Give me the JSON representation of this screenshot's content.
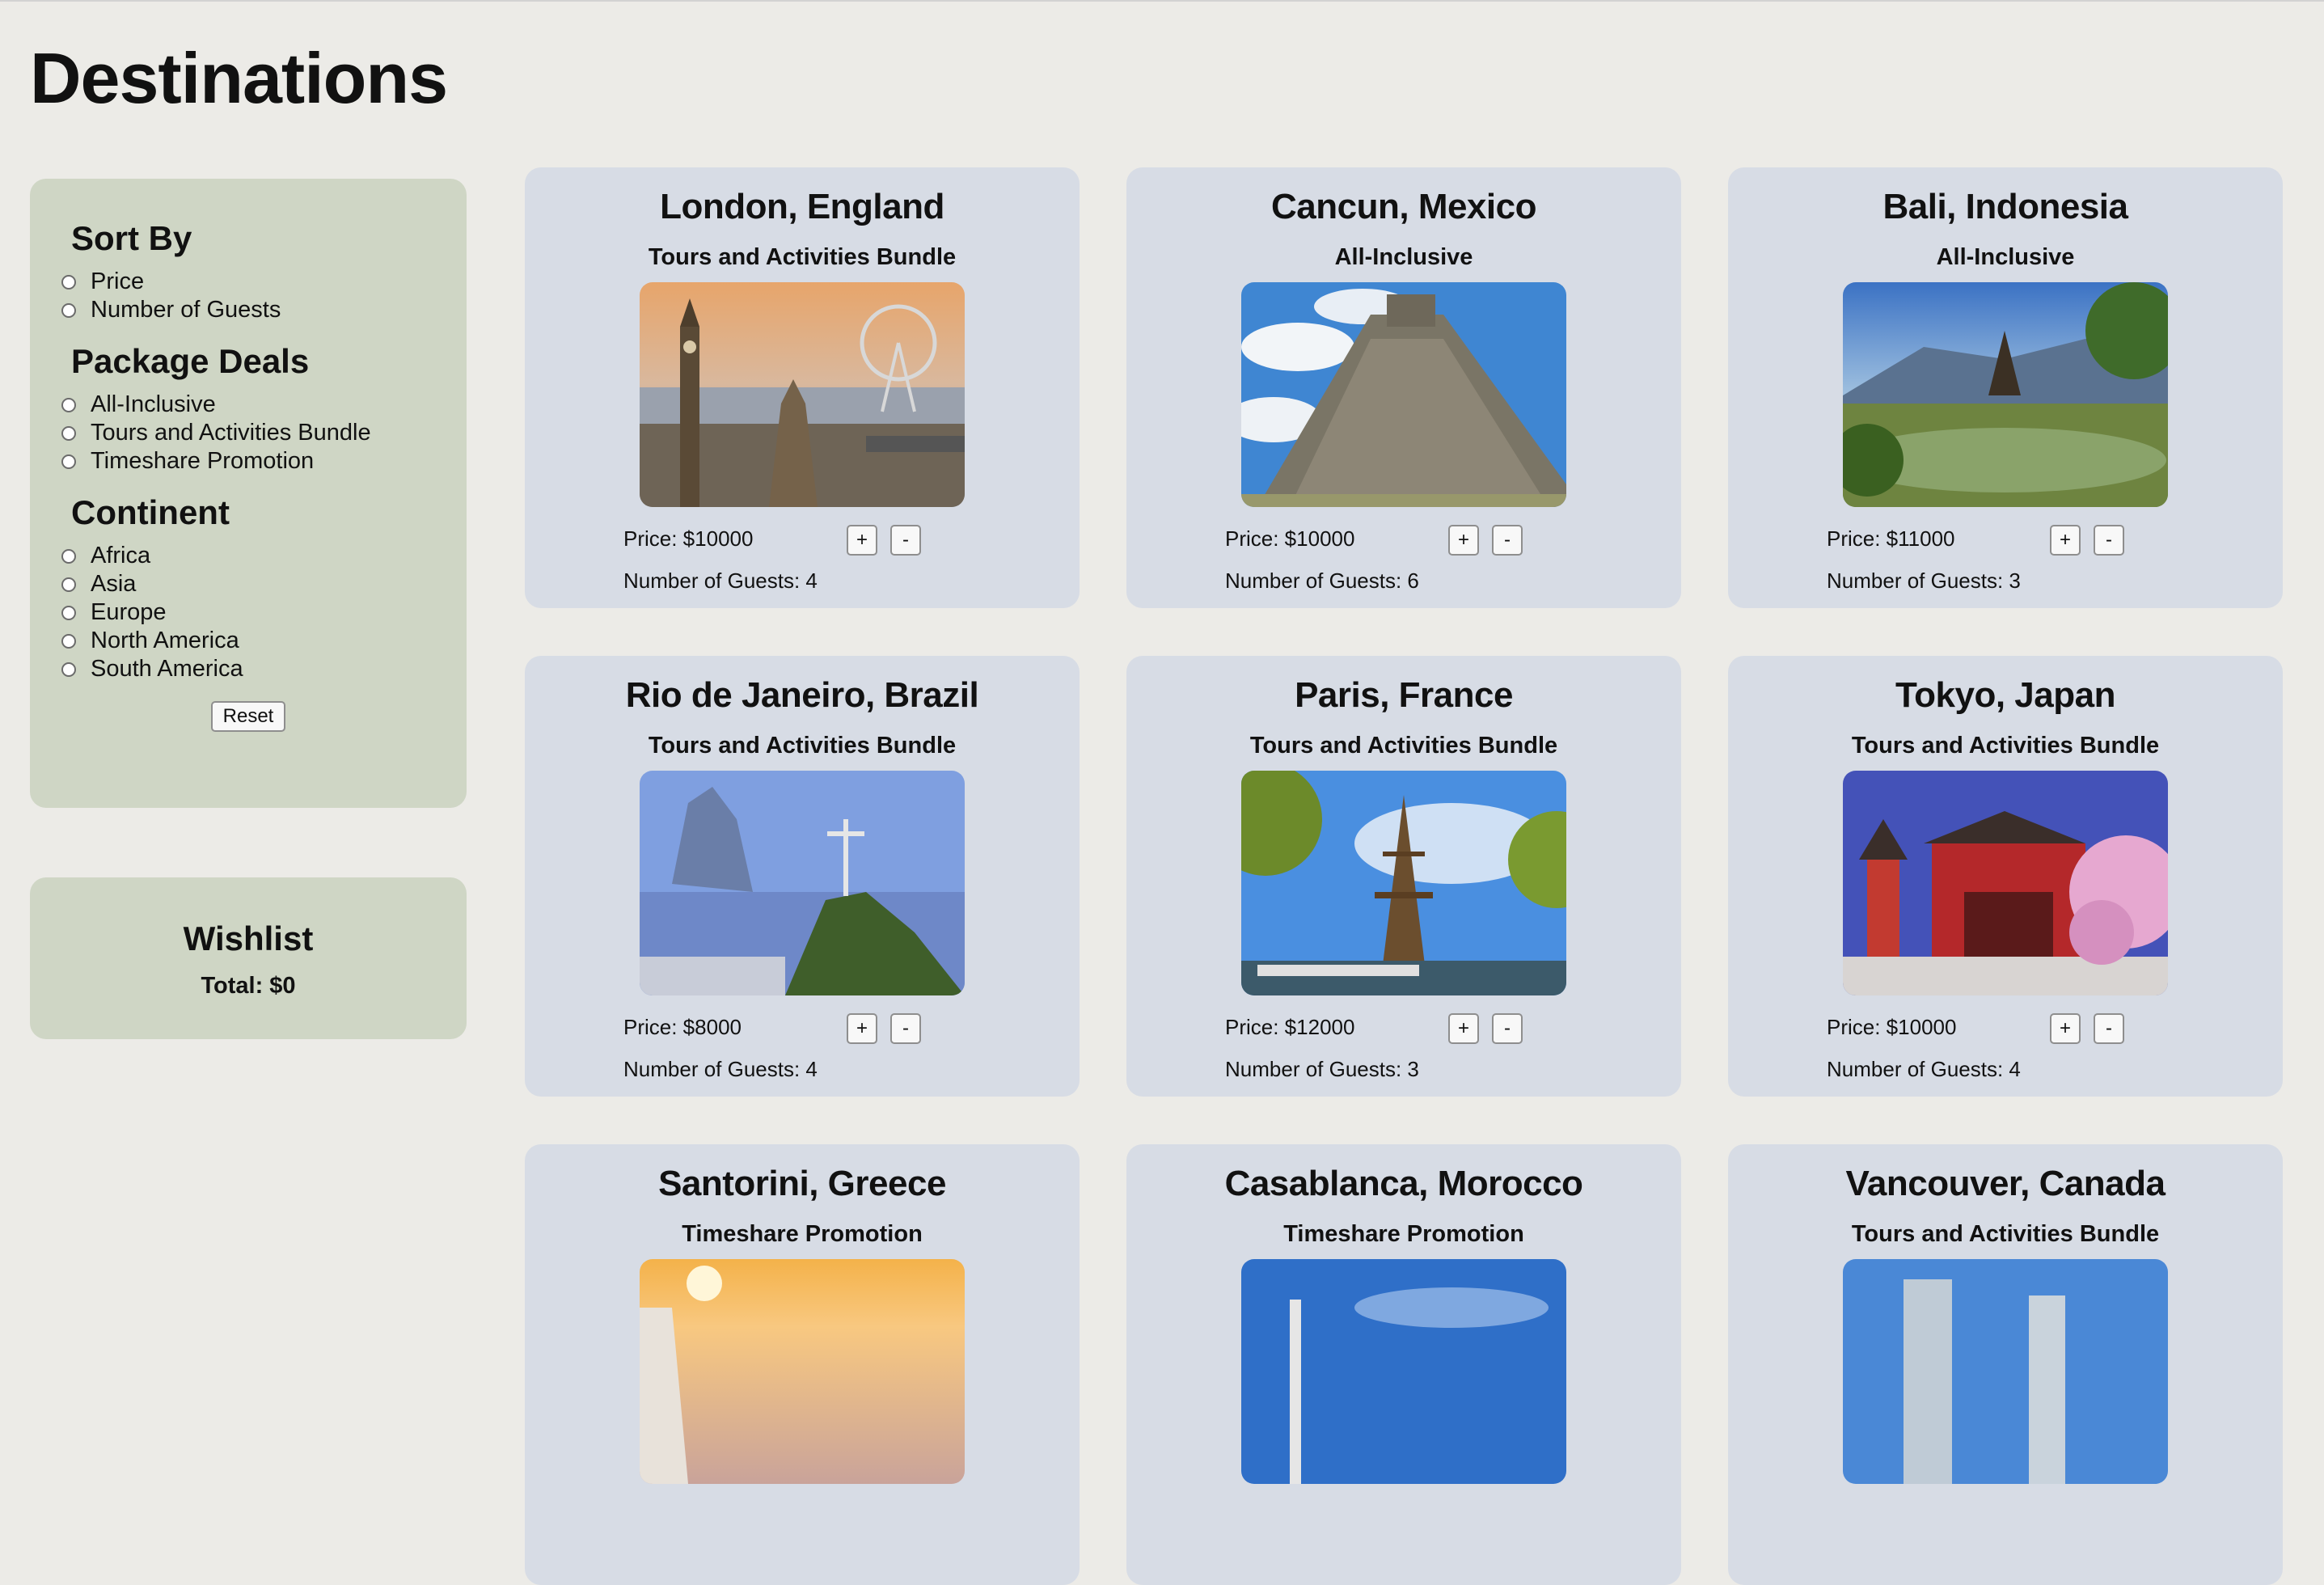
{
  "page": {
    "title": "Destinations"
  },
  "filters": {
    "sort_by": {
      "heading": "Sort By",
      "options": [
        "Price",
        "Number of Guests"
      ]
    },
    "package_deals": {
      "heading": "Package Deals",
      "options": [
        "All-Inclusive",
        "Tours and Activities Bundle",
        "Timeshare Promotion"
      ]
    },
    "continent": {
      "heading": "Continent",
      "options": [
        "Africa",
        "Asia",
        "Europe",
        "North America",
        "South America"
      ]
    },
    "reset_label": "Reset"
  },
  "wishlist": {
    "heading": "Wishlist",
    "total": "Total: $0"
  },
  "destinations": [
    {
      "city": "London, England",
      "deal": "Tours and Activities Bundle",
      "price": "Price: $10000",
      "guests": "Number of Guests: 4",
      "plus": "+",
      "minus": "-"
    },
    {
      "city": "Cancun, Mexico",
      "deal": "All-Inclusive",
      "price": "Price: $10000",
      "guests": "Number of Guests: 6",
      "plus": "+",
      "minus": "-"
    },
    {
      "city": "Bali, Indonesia",
      "deal": "All-Inclusive",
      "price": "Price: $11000",
      "guests": "Number of Guests: 3",
      "plus": "+",
      "minus": "-"
    },
    {
      "city": "Rio de Janeiro, Brazil",
      "deal": "Tours and Activities Bundle",
      "price": "Price: $8000",
      "guests": "Number of Guests: 4",
      "plus": "+",
      "minus": "-"
    },
    {
      "city": "Paris, France",
      "deal": "Tours and Activities Bundle",
      "price": "Price: $12000",
      "guests": "Number of Guests: 3",
      "plus": "+",
      "minus": "-"
    },
    {
      "city": "Tokyo, Japan",
      "deal": "Tours and Activities Bundle",
      "price": "Price: $10000",
      "guests": "Number of Guests: 4",
      "plus": "+",
      "minus": "-"
    },
    {
      "city": "Santorini, Greece",
      "deal": "Timeshare Promotion"
    },
    {
      "city": "Casablanca, Morocco",
      "deal": "Timeshare Promotion"
    },
    {
      "city": "Vancouver, Canada",
      "deal": "Tours and Activities Bundle"
    }
  ]
}
